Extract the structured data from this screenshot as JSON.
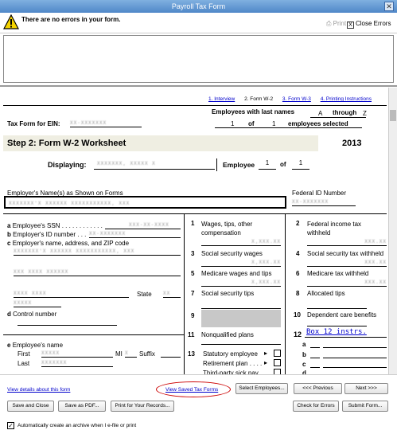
{
  "window": {
    "title": "Payroll Tax Form",
    "close_glyph": "✕"
  },
  "errors": {
    "message": "There are no errors in your form.",
    "print_label": "Print",
    "close_errors_label": "Close Errors",
    "close_errors_glyph": "X"
  },
  "tabs": [
    {
      "label": "1. Interview",
      "active": false
    },
    {
      "label": "2. Form W-2",
      "active": true
    },
    {
      "label": "3. Form W-3",
      "active": false
    },
    {
      "label": "4. Printing Instructions",
      "active": false
    }
  ],
  "ein": {
    "label": "Tax Form for EIN:",
    "value": "XX-XXXXXXX"
  },
  "selection": {
    "heading": "Employees with last names",
    "from": "A",
    "through_label": "through",
    "to": "Z",
    "count": "1",
    "of_label": "of",
    "total": "1",
    "selected_label": "employees selected"
  },
  "step": {
    "title": "Step 2:  Form W-2 Worksheet",
    "year": "2013"
  },
  "displaying": {
    "label": "Displaying:",
    "value": "XXXXXXX, XXXXX X",
    "employee_label": "Employee",
    "index": "1",
    "of_label": "of",
    "total": "1"
  },
  "employer_name": {
    "label": "Employer's Name(s) as Shown on Forms",
    "value": "XXXXXXX'X XXXXXX XXXXXXXXXXX, XXX"
  },
  "federal_id": {
    "label": "Federal ID Number",
    "value": "XX-XXXXXXX"
  },
  "left_fields": {
    "a": {
      "letter": "a",
      "label": "Employee's SSN",
      "dots": ". . . . . . . . . . . .",
      "value": "XXX-XX-XXXX"
    },
    "b": {
      "letter": "b",
      "label": "Employer's ID number",
      "dots": ". . .",
      "value": "XX-XXXXXXX"
    },
    "c": {
      "letter": "c",
      "label": "Employer's name, address, and ZIP code",
      "name": "XXXXXXX'X XXXXXX XXXXXXXXXXX, XXX",
      "street": "XXX XXXX XXXXXX",
      "city": "XXXX XXXX",
      "state_label": "State",
      "state": "XX",
      "zip": "XXXXX"
    },
    "d": {
      "letter": "d",
      "label": "Control number"
    },
    "e": {
      "letter": "e",
      "label": "Employee's name",
      "first_label": "First",
      "first": "XXXXX",
      "mi_label": "MI",
      "mi": "X",
      "suffix_label": "Suffix",
      "last_label": "Last",
      "last": "XXXXXXX"
    }
  },
  "middle_fields": {
    "b1": {
      "num": "1",
      "label": "Wages, tips, other compensation",
      "value": "X,XXX.XX"
    },
    "b3": {
      "num": "3",
      "label": "Social security wages",
      "value": "X,XXX.XX"
    },
    "b5": {
      "num": "5",
      "label": "Medicare wages and tips",
      "value": "X,XXX.XX"
    },
    "b7": {
      "num": "7",
      "label": "Social security tips"
    },
    "b9": {
      "num": "9"
    },
    "b11": {
      "num": "11",
      "label": "Nonqualified plans"
    },
    "b13": {
      "num": "13",
      "statutory": "Statutory employee",
      "retirement": "Retirement plan . . . .",
      "third_party": "Third-party sick pay",
      "arrow": "▸"
    }
  },
  "right_fields": {
    "b2": {
      "num": "2",
      "label": "Federal income tax withheld",
      "value": "XXX.XX"
    },
    "b4": {
      "num": "4",
      "label": "Social security tax withheld",
      "value": "XXX.XX"
    },
    "b6": {
      "num": "6",
      "label": "Medicare tax withheld",
      "value": "XXX.XX"
    },
    "b8": {
      "num": "8",
      "label": "Allocated tips"
    },
    "b10": {
      "num": "10",
      "label": "Dependent care benefits"
    },
    "b12": {
      "num": "12",
      "link": "Box 12 instrs.",
      "rows": [
        "a",
        "b",
        "c",
        "d"
      ]
    }
  },
  "footer": {
    "view_details": "View details about this form",
    "view_saved": "View Saved Tax Forms",
    "select_employees": "Select Employees...",
    "previous": "<<<  Previous",
    "next": "Next  >>>",
    "save_close": "Save and Close",
    "save_pdf": "Save as PDF...",
    "print_records": "Print for Your Records...",
    "check_errors": "Check for Errors",
    "submit": "Submit Form...",
    "archive_label": "Automatically create an archive when I e-file or print",
    "archive_checked": true,
    "check_glyph": "✓"
  }
}
